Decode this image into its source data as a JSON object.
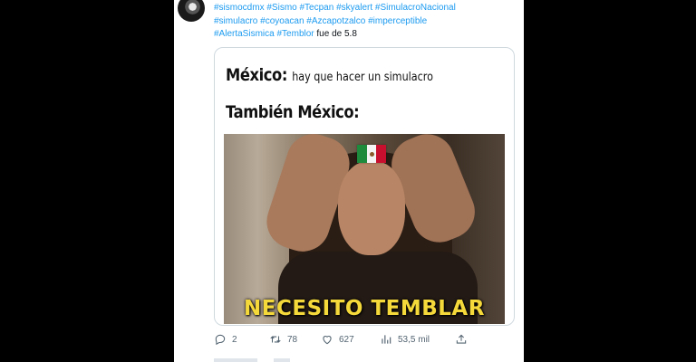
{
  "tweet": {
    "hashtags_line1": [
      "#sismocdmx",
      "#Sismo",
      "#Tecpan",
      "#skyalert",
      "#SimulacroNacional"
    ],
    "hashtags_line2": [
      "#simulacro",
      "#coyoacan",
      "#Azcapotzalco",
      "#imperceptible"
    ],
    "hashtags_line3": [
      "#AlertaSismica",
      "#Temblor"
    ],
    "text_suffix": "fue de 5.8"
  },
  "meme": {
    "line1_bold": "México:",
    "line1_rest": "hay que hacer un simulacro",
    "line2": "También México:",
    "caption": "NECESITO TEMBLAR"
  },
  "actions": {
    "replies": "2",
    "retweets": "78",
    "likes": "627",
    "views": "53,5 mil"
  },
  "icons": {
    "reply": "reply-icon",
    "retweet": "retweet-icon",
    "like": "heart-icon",
    "views": "views-icon",
    "share": "share-icon"
  },
  "colors": {
    "hashtag": "#1d9bf0",
    "text": "#0f1419",
    "muted": "#536471",
    "caption": "#f5d93b"
  }
}
